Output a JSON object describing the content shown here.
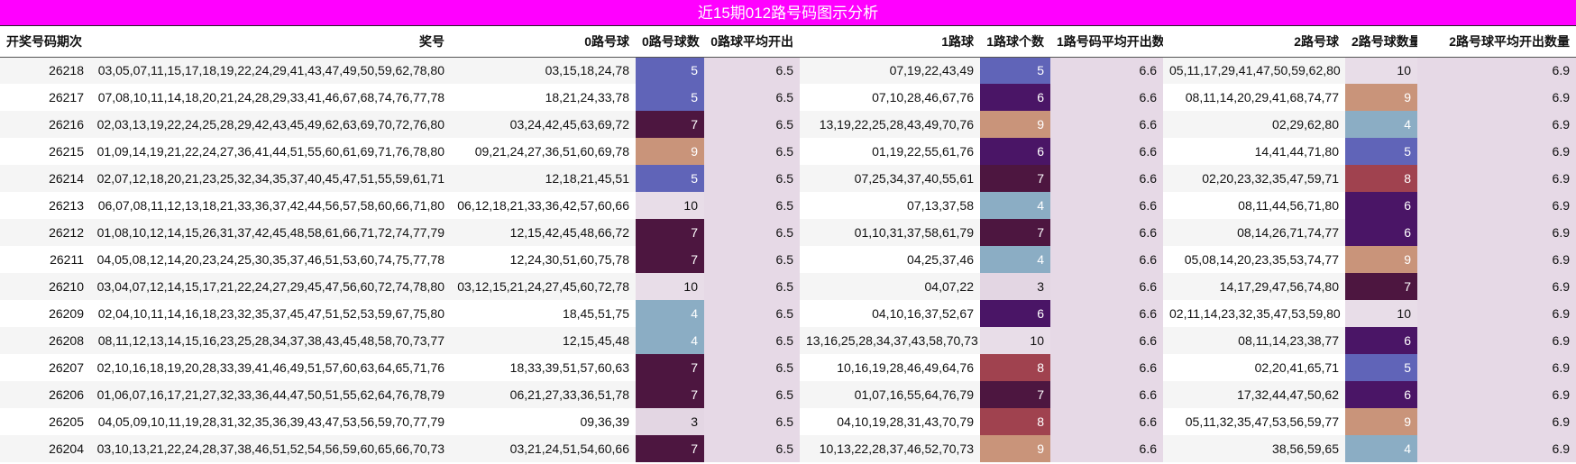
{
  "title": "近15期012路号码图示分析",
  "headers": [
    "开奖号码期次",
    "奖号",
    "0路号球",
    "0路号球数",
    "0路球平均开出",
    "1路球",
    "1路球个数",
    "1路号码平均开出数",
    "2路号球",
    "2路号球数量",
    "2路号球平均开出数量"
  ],
  "colors": {
    "title_bg": "#ff00ff",
    "avg_bg": "#e6d9e6",
    "count_scale": {
      "3": "#e3d6e3",
      "4": "#8badc4",
      "5": "#6064b8",
      "6": "#4a1566",
      "7": "#4d1640",
      "8": "#a0424f",
      "9": "#c9947a",
      "10": "#e8dde8"
    }
  },
  "rows": [
    {
      "period": "26218",
      "numbers": "03,05,07,11,15,17,18,19,22,24,29,41,43,47,49,50,59,62,78,80",
      "r0": "03,15,18,24,78",
      "r0_count": "5",
      "r0_avg": "6.5",
      "r1": "07,19,22,43,49",
      "r1_count": "5",
      "r1_avg": "6.6",
      "r2": "05,11,17,29,41,47,50,59,62,80",
      "r2_count": "10",
      "r2_avg": "6.9"
    },
    {
      "period": "26217",
      "numbers": "07,08,10,11,14,18,20,21,24,28,29,33,41,46,67,68,74,76,77,78",
      "r0": "18,21,24,33,78",
      "r0_count": "5",
      "r0_avg": "6.5",
      "r1": "07,10,28,46,67,76",
      "r1_count": "6",
      "r1_avg": "6.6",
      "r2": "08,11,14,20,29,41,68,74,77",
      "r2_count": "9",
      "r2_avg": "6.9"
    },
    {
      "period": "26216",
      "numbers": "02,03,13,19,22,24,25,28,29,42,43,45,49,62,63,69,70,72,76,80",
      "r0": "03,24,42,45,63,69,72",
      "r0_count": "7",
      "r0_avg": "6.5",
      "r1": "13,19,22,25,28,43,49,70,76",
      "r1_count": "9",
      "r1_avg": "6.6",
      "r2": "02,29,62,80",
      "r2_count": "4",
      "r2_avg": "6.9"
    },
    {
      "period": "26215",
      "numbers": "01,09,14,19,21,22,24,27,36,41,44,51,55,60,61,69,71,76,78,80",
      "r0": "09,21,24,27,36,51,60,69,78",
      "r0_count": "9",
      "r0_avg": "6.5",
      "r1": "01,19,22,55,61,76",
      "r1_count": "6",
      "r1_avg": "6.6",
      "r2": "14,41,44,71,80",
      "r2_count": "5",
      "r2_avg": "6.9"
    },
    {
      "period": "26214",
      "numbers": "02,07,12,18,20,21,23,25,32,34,35,37,40,45,47,51,55,59,61,71",
      "r0": "12,18,21,45,51",
      "r0_count": "5",
      "r0_avg": "6.5",
      "r1": "07,25,34,37,40,55,61",
      "r1_count": "7",
      "r1_avg": "6.6",
      "r2": "02,20,23,32,35,47,59,71",
      "r2_count": "8",
      "r2_avg": "6.9"
    },
    {
      "period": "26213",
      "numbers": "06,07,08,11,12,13,18,21,33,36,37,42,44,56,57,58,60,66,71,80",
      "r0": "06,12,18,21,33,36,42,57,60,66",
      "r0_count": "10",
      "r0_avg": "6.5",
      "r1": "07,13,37,58",
      "r1_count": "4",
      "r1_avg": "6.6",
      "r2": "08,11,44,56,71,80",
      "r2_count": "6",
      "r2_avg": "6.9"
    },
    {
      "period": "26212",
      "numbers": "01,08,10,12,14,15,26,31,37,42,45,48,58,61,66,71,72,74,77,79",
      "r0": "12,15,42,45,48,66,72",
      "r0_count": "7",
      "r0_avg": "6.5",
      "r1": "01,10,31,37,58,61,79",
      "r1_count": "7",
      "r1_avg": "6.6",
      "r2": "08,14,26,71,74,77",
      "r2_count": "6",
      "r2_avg": "6.9"
    },
    {
      "period": "26211",
      "numbers": "04,05,08,12,14,20,23,24,25,30,35,37,46,51,53,60,74,75,77,78",
      "r0": "12,24,30,51,60,75,78",
      "r0_count": "7",
      "r0_avg": "6.5",
      "r1": "04,25,37,46",
      "r1_count": "4",
      "r1_avg": "6.6",
      "r2": "05,08,14,20,23,35,53,74,77",
      "r2_count": "9",
      "r2_avg": "6.9"
    },
    {
      "period": "26210",
      "numbers": "03,04,07,12,14,15,17,21,22,24,27,29,45,47,56,60,72,74,78,80",
      "r0": "03,12,15,21,24,27,45,60,72,78",
      "r0_count": "10",
      "r0_avg": "6.5",
      "r1": "04,07,22",
      "r1_count": "3",
      "r1_avg": "6.6",
      "r2": "14,17,29,47,56,74,80",
      "r2_count": "7",
      "r2_avg": "6.9"
    },
    {
      "period": "26209",
      "numbers": "02,04,10,11,14,16,18,23,32,35,37,45,47,51,52,53,59,67,75,80",
      "r0": "18,45,51,75",
      "r0_count": "4",
      "r0_avg": "6.5",
      "r1": "04,10,16,37,52,67",
      "r1_count": "6",
      "r1_avg": "6.6",
      "r2": "02,11,14,23,32,35,47,53,59,80",
      "r2_count": "10",
      "r2_avg": "6.9"
    },
    {
      "period": "26208",
      "numbers": "08,11,12,13,14,15,16,23,25,28,34,37,38,43,45,48,58,70,73,77",
      "r0": "12,15,45,48",
      "r0_count": "4",
      "r0_avg": "6.5",
      "r1": "13,16,25,28,34,37,43,58,70,73",
      "r1_count": "10",
      "r1_avg": "6.6",
      "r2": "08,11,14,23,38,77",
      "r2_count": "6",
      "r2_avg": "6.9"
    },
    {
      "period": "26207",
      "numbers": "02,10,16,18,19,20,28,33,39,41,46,49,51,57,60,63,64,65,71,76",
      "r0": "18,33,39,51,57,60,63",
      "r0_count": "7",
      "r0_avg": "6.5",
      "r1": "10,16,19,28,46,49,64,76",
      "r1_count": "8",
      "r1_avg": "6.6",
      "r2": "02,20,41,65,71",
      "r2_count": "5",
      "r2_avg": "6.9"
    },
    {
      "period": "26206",
      "numbers": "01,06,07,16,17,21,27,32,33,36,44,47,50,51,55,62,64,76,78,79",
      "r0": "06,21,27,33,36,51,78",
      "r0_count": "7",
      "r0_avg": "6.5",
      "r1": "01,07,16,55,64,76,79",
      "r1_count": "7",
      "r1_avg": "6.6",
      "r2": "17,32,44,47,50,62",
      "r2_count": "6",
      "r2_avg": "6.9"
    },
    {
      "period": "26205",
      "numbers": "04,05,09,10,11,19,28,31,32,35,36,39,43,47,53,56,59,70,77,79",
      "r0": "09,36,39",
      "r0_count": "3",
      "r0_avg": "6.5",
      "r1": "04,10,19,28,31,43,70,79",
      "r1_count": "8",
      "r1_avg": "6.6",
      "r2": "05,11,32,35,47,53,56,59,77",
      "r2_count": "9",
      "r2_avg": "6.9"
    },
    {
      "period": "26204",
      "numbers": "03,10,13,21,22,24,28,37,38,46,51,52,54,56,59,60,65,66,70,73",
      "r0": "03,21,24,51,54,60,66",
      "r0_count": "7",
      "r0_avg": "6.5",
      "r1": "10,13,22,28,37,46,52,70,73",
      "r1_count": "9",
      "r1_avg": "6.6",
      "r2": "38,56,59,65",
      "r2_count": "4",
      "r2_avg": "6.9"
    }
  ]
}
